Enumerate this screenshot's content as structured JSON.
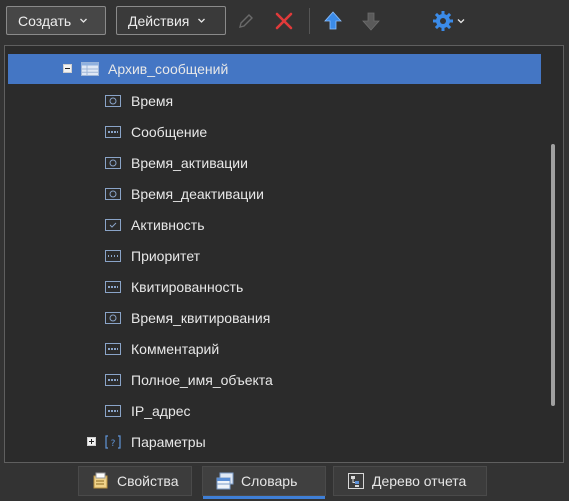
{
  "toolbar": {
    "create_label": "Создать",
    "actions_label": "Действия",
    "icons": [
      "edit-icon",
      "delete-icon",
      "move-up-icon",
      "move-down-icon",
      "gear-icon"
    ],
    "colors": {
      "delete": "#e03a3a",
      "move_up": "#3b8be8",
      "gear": "#3b8be8"
    }
  },
  "tree": {
    "root": {
      "label": "Архив_сообщений",
      "icon": "table-icon",
      "expanded": true,
      "selected": true
    },
    "children": [
      {
        "label": "Время",
        "icon": "datetime-field-icon"
      },
      {
        "label": "Сообщение",
        "icon": "string-field-icon"
      },
      {
        "label": "Время_активации",
        "icon": "datetime-field-icon"
      },
      {
        "label": "Время_деактивации",
        "icon": "datetime-field-icon"
      },
      {
        "label": "Активность",
        "icon": "boolean-field-icon"
      },
      {
        "label": "Приоритет",
        "icon": "number-field-icon"
      },
      {
        "label": "Квитированность",
        "icon": "string-field-icon"
      },
      {
        "label": "Время_квитирования",
        "icon": "datetime-field-icon"
      },
      {
        "label": "Комментарий",
        "icon": "string-field-icon"
      },
      {
        "label": "Полное_имя_объекта",
        "icon": "string-field-icon"
      },
      {
        "label": "IP_адрес",
        "icon": "string-field-icon"
      }
    ],
    "params": {
      "label": "Параметры",
      "icon": "parameters-icon",
      "expanded": false
    }
  },
  "tabs": [
    {
      "label": "Свойства",
      "icon": "properties-icon"
    },
    {
      "label": "Словарь",
      "icon": "dictionary-icon",
      "active": true
    },
    {
      "label": "Дерево отчета",
      "icon": "report-tree-icon"
    }
  ],
  "colors": {
    "selection": "#4476c4",
    "active_tab_underline": "#3f7fd6",
    "panel_bg": "#2b2b2b"
  }
}
